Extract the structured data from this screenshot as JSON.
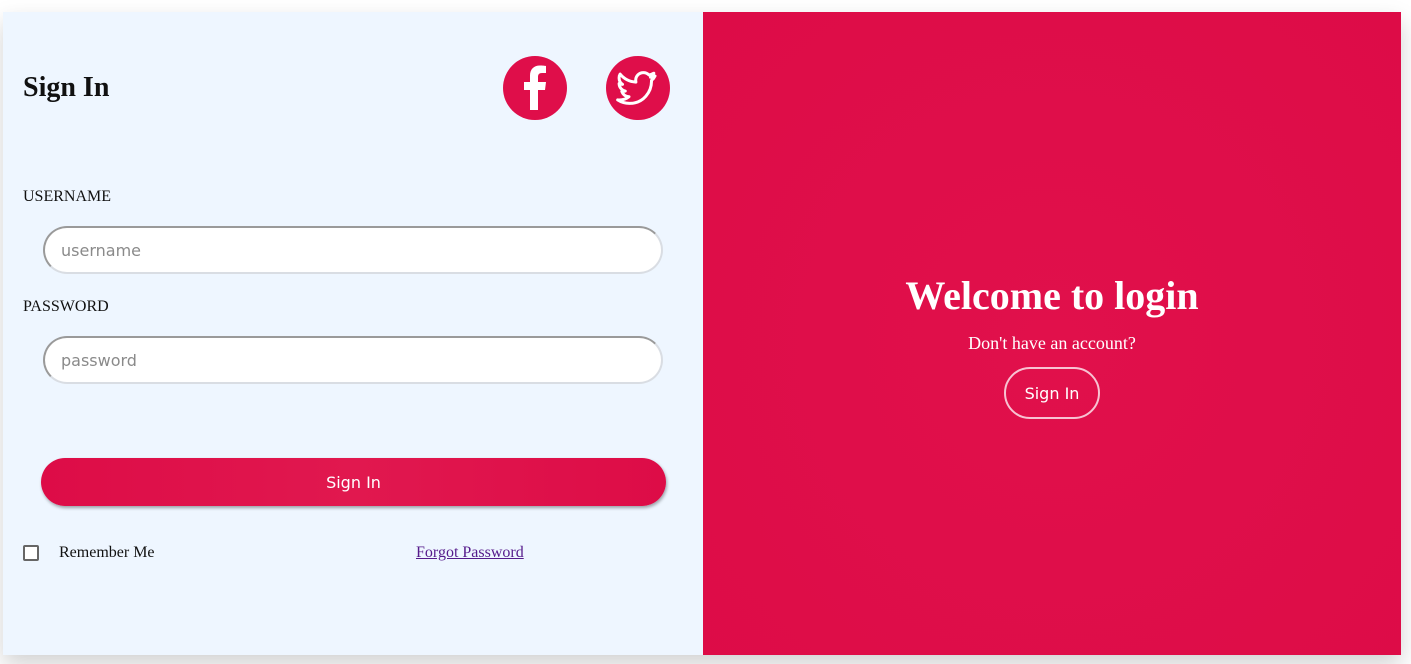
{
  "left": {
    "title": "Sign In",
    "social": {
      "facebook_icon": "facebook-icon",
      "twitter_icon": "twitter-icon"
    },
    "username": {
      "label": "USERNAME",
      "placeholder": "username",
      "value": ""
    },
    "password": {
      "label": "PASSWORD",
      "placeholder": "password",
      "value": ""
    },
    "submit_label": "Sign In",
    "remember_label": "Remember Me",
    "remember_checked": false,
    "forgot_label": "Forgot Password"
  },
  "right": {
    "title": "Welcome to login",
    "subtitle": "Don't have an account?",
    "button_label": "Sign In"
  },
  "colors": {
    "accent": "#df0e4a",
    "left_bg": "#eef6ff",
    "link": "#551a8b"
  }
}
